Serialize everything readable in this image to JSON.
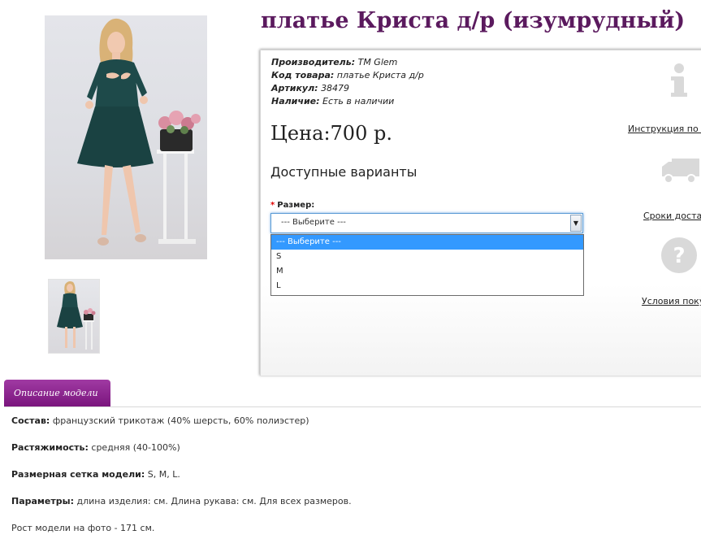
{
  "product": {
    "title": "платье Криста д/р (изумрудный)",
    "manufacturer_label": "Производитель:",
    "manufacturer": "TM Glem",
    "code_label": "Код товара:",
    "code": "платье Криста д/р",
    "sku_label": "Артикул:",
    "sku": "38479",
    "stock_label": "Наличие:",
    "stock": "Есть в наличии",
    "price": "Цена:700 р."
  },
  "options": {
    "heading": "Доступные варианты",
    "size_label": "Размер:",
    "required_mark": "*",
    "selected": "--- Выберите ---",
    "items": [
      "--- Выберите ---",
      "S",
      "M",
      "L"
    ]
  },
  "info_links": {
    "instruction": "Инструкция по п",
    "delivery": "Сроки достав",
    "conditions": "Условия поку"
  },
  "tabs": {
    "description": "Описание модели"
  },
  "description": {
    "composition_label": "Состав:",
    "composition": "французский трикотаж (40% шерсть, 60% полиэстер)",
    "stretch_label": "Растяжимость:",
    "stretch": "средняя (40-100%)",
    "sizes_label": "Размерная сетка модели:",
    "sizes": "S, M, L.",
    "params_label": "Параметры:",
    "params": "длина изделия: см. Длина рукава: см. Для всех размеров.",
    "model_height": "Рост модели на фото - 171 см."
  },
  "colors": {
    "title": "#5b1a5e",
    "tab": "#8a2a8d",
    "dress": "#1e4a4a",
    "select_highlight": "#3399ff"
  }
}
